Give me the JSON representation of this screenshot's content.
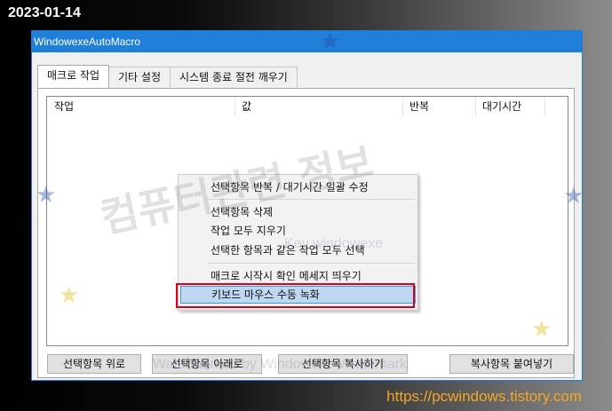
{
  "date_stamp": "2023-01-14",
  "site_url": "https://pcwindows.tistory.com",
  "window": {
    "title": "WindowexeAutoMacro"
  },
  "tabs": [
    "매크로 작업",
    "기타 설정",
    "시스템 종료 절전 깨우기"
  ],
  "list": {
    "columns": [
      "작업",
      "값",
      "반복",
      "대기시간"
    ]
  },
  "context_menu": {
    "items": [
      "선택항목 반복 / 대기시간 일괄 수정",
      "선택항목 삭제",
      "작업 모두 지우기",
      "선택한 항목과 같은 작업 모두 선택",
      "매크로 시작시 확인 메세지 띄우기",
      "키보드 마우스 수동 녹화"
    ],
    "highlighted": "키보드 마우스 수동 녹화"
  },
  "buttons": [
    "선택항목 위로",
    "선택항목 아래로",
    "선택항목 복사하기",
    "복사항목 붙여넣기"
  ],
  "watermarks": {
    "main": "컴퓨터관련 정보",
    "key": "Key windowexe",
    "bottom": "Watermarked by Windowexe Watermark"
  },
  "colors": {
    "accent": "#1f7fd9",
    "highlight": "#bdd8f0",
    "outline": "#d9001b",
    "url": "#f5a623"
  }
}
